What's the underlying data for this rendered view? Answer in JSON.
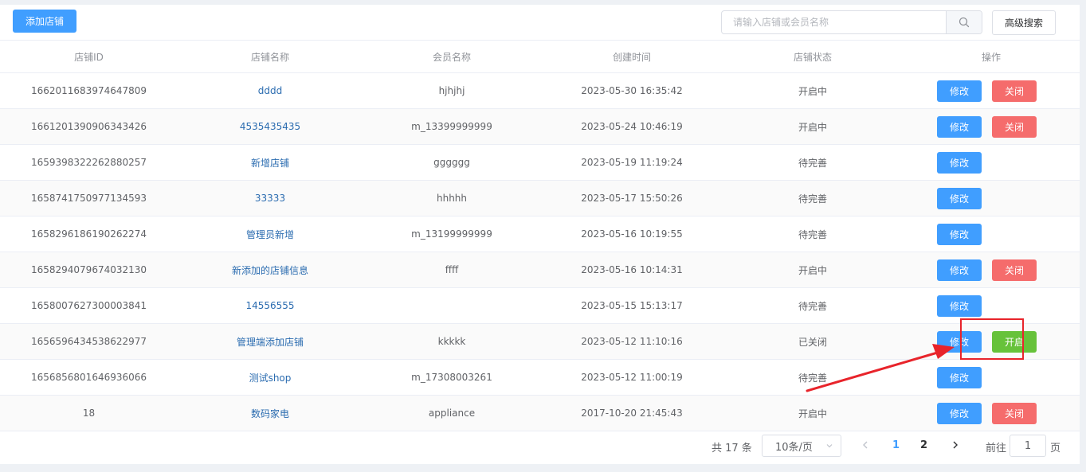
{
  "toolbar": {
    "add_label": "添加店铺",
    "search_placeholder": "请输入店铺或会员名称",
    "advanced_label": "高级搜索"
  },
  "table": {
    "columns": [
      "店铺ID",
      "店铺名称",
      "会员名称",
      "创建时间",
      "店铺状态",
      "操作"
    ],
    "rows": [
      {
        "id": "1662011683974647809",
        "shop": "dddd",
        "member": "hjhjhj",
        "created": "2023-05-30 16:35:42",
        "status": "开启中",
        "actions": [
          "修改",
          "关闭"
        ]
      },
      {
        "id": "1661201390906343426",
        "shop": "4535435435",
        "member": "m_13399999999",
        "created": "2023-05-24 10:46:19",
        "status": "开启中",
        "actions": [
          "修改",
          "关闭"
        ]
      },
      {
        "id": "1659398322262880257",
        "shop": "新增店铺",
        "member": "gggggg",
        "created": "2023-05-19 11:19:24",
        "status": "待完善",
        "actions": [
          "修改"
        ]
      },
      {
        "id": "1658741750977134593",
        "shop": "33333",
        "member": "hhhhh",
        "created": "2023-05-17 15:50:26",
        "status": "待完善",
        "actions": [
          "修改"
        ]
      },
      {
        "id": "1658296186190262274",
        "shop": "管理员新增",
        "member": "m_13199999999",
        "created": "2023-05-16 10:19:55",
        "status": "待完善",
        "actions": [
          "修改"
        ]
      },
      {
        "id": "1658294079674032130",
        "shop": "新添加的店铺信息",
        "member": "ffff",
        "created": "2023-05-16 10:14:31",
        "status": "开启中",
        "actions": [
          "修改",
          "关闭"
        ]
      },
      {
        "id": "1658007627300003841",
        "shop": "14556555",
        "member": "",
        "created": "2023-05-15 15:13:17",
        "status": "待完善",
        "actions": [
          "修改"
        ]
      },
      {
        "id": "1656596434538622977",
        "shop": "管理端添加店铺",
        "member": "kkkkk",
        "created": "2023-05-12 11:10:16",
        "status": "已关闭",
        "actions": [
          "修改",
          "开启"
        ]
      },
      {
        "id": "1656856801646936066",
        "shop": "测试shop",
        "member": "m_17308003261",
        "created": "2023-05-12 11:00:19",
        "status": "待完善",
        "actions": [
          "修改"
        ]
      },
      {
        "id": "18",
        "shop": "数码家电",
        "member": "appliance",
        "created": "2017-10-20 21:45:43",
        "status": "开启中",
        "actions": [
          "修改",
          "关闭"
        ]
      }
    ]
  },
  "pagination": {
    "total_text": "共 17 条",
    "page_size": "10条/页",
    "pages": [
      "1",
      "2"
    ],
    "current_page": "1",
    "goto_prefix": "前往",
    "goto_value": "1",
    "goto_suffix": "页"
  },
  "colors": {
    "primary": "#409eff",
    "danger": "#f56c6c",
    "success": "#67c23a",
    "annotation": "#e8242b"
  }
}
